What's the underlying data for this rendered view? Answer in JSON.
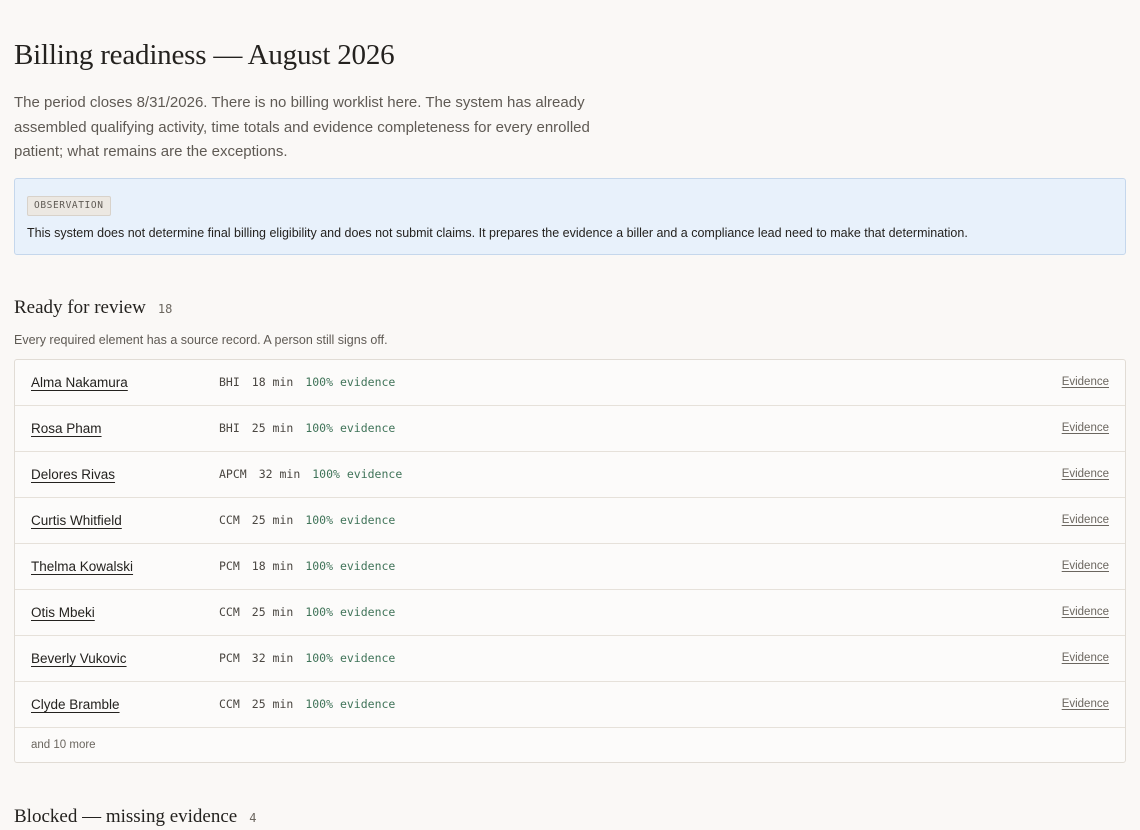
{
  "page": {
    "title": "Billing readiness — August 2026",
    "intro": "The period closes 8/31/2026. There is no billing worklist here. The system has already assembled qualifying activity, time totals and evidence completeness for every enrolled patient; what remains are the exceptions."
  },
  "observation": {
    "tag": "OBSERVATION",
    "text": "This system does not determine final billing eligibility and does not submit claims. It prepares the evidence a biller and a compliance lead need to make that determination."
  },
  "ready": {
    "title": "Ready for review",
    "count": "18",
    "description": "Every required element has a source record. A person still signs off.",
    "rows": [
      {
        "name": "Alma Nakamura",
        "program": "BHI",
        "minutes": "18 min",
        "evidence": "100% evidence",
        "link": "Evidence"
      },
      {
        "name": "Rosa Pham",
        "program": "BHI",
        "minutes": "25 min",
        "evidence": "100% evidence",
        "link": "Evidence"
      },
      {
        "name": "Delores Rivas",
        "program": "APCM",
        "minutes": "32 min",
        "evidence": "100% evidence",
        "link": "Evidence"
      },
      {
        "name": "Curtis Whitfield",
        "program": "CCM",
        "minutes": "25 min",
        "evidence": "100% evidence",
        "link": "Evidence"
      },
      {
        "name": "Thelma Kowalski",
        "program": "PCM",
        "minutes": "18 min",
        "evidence": "100% evidence",
        "link": "Evidence"
      },
      {
        "name": "Otis Mbeki",
        "program": "CCM",
        "minutes": "25 min",
        "evidence": "100% evidence",
        "link": "Evidence"
      },
      {
        "name": "Beverly Vukovic",
        "program": "PCM",
        "minutes": "32 min",
        "evidence": "100% evidence",
        "link": "Evidence"
      },
      {
        "name": "Clyde Bramble",
        "program": "CCM",
        "minutes": "25 min",
        "evidence": "100% evidence",
        "link": "Evidence"
      }
    ],
    "more": "and 10 more"
  },
  "blocked": {
    "title": "Blocked — missing evidence",
    "count": "4"
  }
}
